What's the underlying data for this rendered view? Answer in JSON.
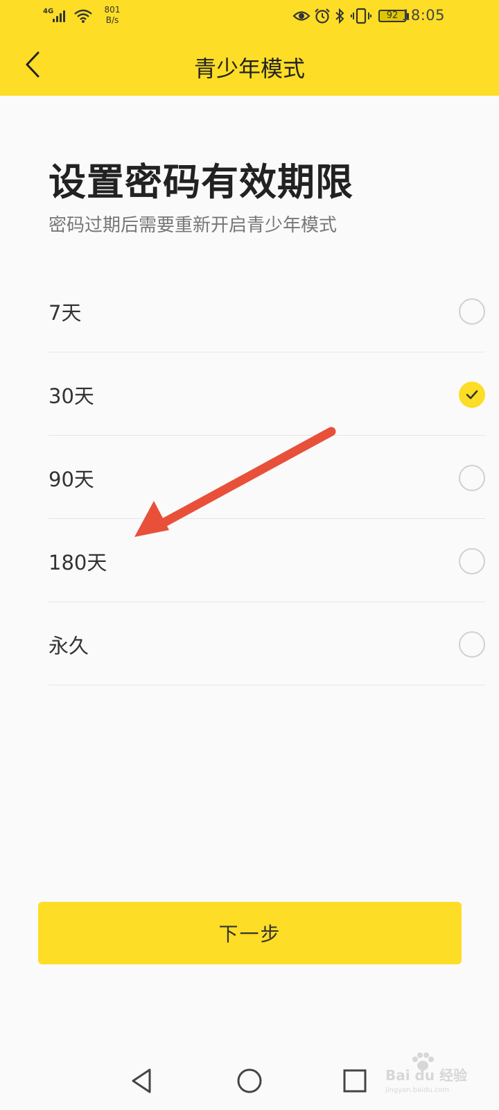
{
  "status_bar": {
    "network": "4G",
    "speed_value": "801",
    "speed_unit": "B/s",
    "battery": "92",
    "time": "18:05",
    "icons": [
      "signal-icon",
      "wifi-icon",
      "eye-icon",
      "alarm-icon",
      "bluetooth-icon",
      "vibrate-icon",
      "battery-icon"
    ]
  },
  "header": {
    "title": "青少年模式",
    "back_icon": "chevron-left-icon"
  },
  "main": {
    "heading": "设置密码有效期限",
    "subheading": "密码过期后需要重新开启青少年模式",
    "options": [
      {
        "label": "7天",
        "selected": false
      },
      {
        "label": "30天",
        "selected": true
      },
      {
        "label": "90天",
        "selected": false
      },
      {
        "label": "180天",
        "selected": false
      },
      {
        "label": "永久",
        "selected": false
      }
    ],
    "next_button": "下一步"
  },
  "nav_bar": {
    "icons": [
      "back-triangle-icon",
      "home-circle-icon",
      "recents-square-icon"
    ]
  },
  "watermark": {
    "brand": "Bai du 经验",
    "url": "jingyan.baidu.com"
  },
  "colors": {
    "accent": "#fddd25",
    "arrow": "#e8503a",
    "text_primary": "#222222",
    "text_secondary": "#777777"
  }
}
